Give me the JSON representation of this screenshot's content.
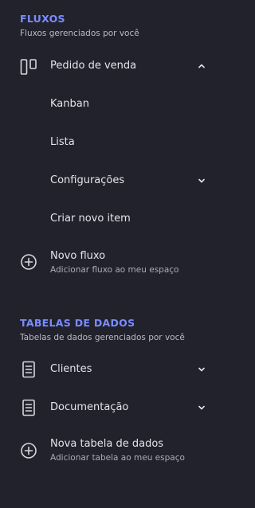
{
  "fluxos": {
    "title": "FLUXOS",
    "subtitle": "Fluxos gerenciados por você",
    "flow": {
      "label": "Pedido de venda",
      "icon": "kanban-board-icon",
      "expanded": true,
      "items": [
        {
          "label": "Kanban"
        },
        {
          "label": "Lista"
        },
        {
          "label": "Configurações"
        },
        {
          "label": "Criar novo item"
        }
      ]
    },
    "new_flow": {
      "label": "Novo fluxo",
      "sublabel": "Adicionar fluxo ao meu espaço",
      "icon": "plus-circle-icon"
    }
  },
  "tabelas": {
    "title": "TABELAS DE DADOS",
    "subtitle": "Tabelas de dados gerenciados por você",
    "items": [
      {
        "label": "Clientes",
        "icon": "document-icon"
      },
      {
        "label": "Documentação",
        "icon": "document-icon"
      }
    ],
    "new_table": {
      "label": "Nova tabela de dados",
      "sublabel": "Adicionar tabela ao meu espaço",
      "icon": "plus-circle-icon"
    }
  },
  "colors": {
    "background": "#21222c",
    "accent": "#7b8cff",
    "text": "#e4e5ea"
  }
}
